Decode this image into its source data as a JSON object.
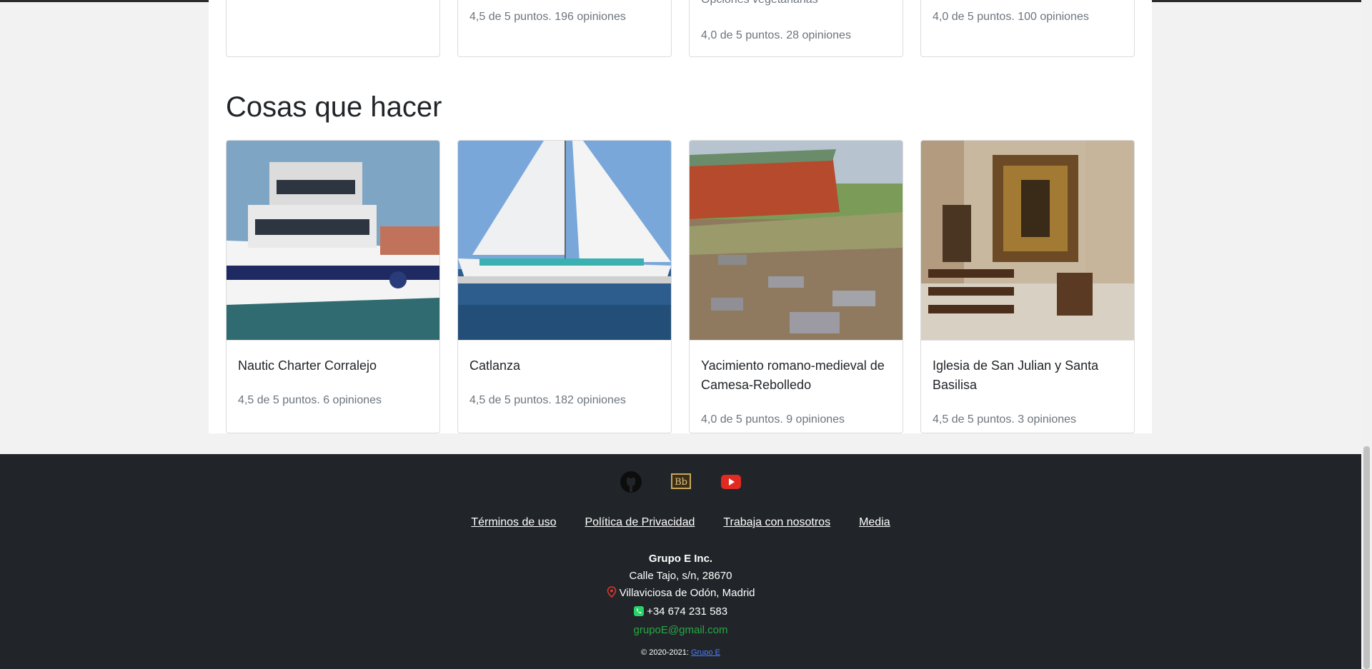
{
  "top_cards": [
    {
      "extra": "",
      "rating": ""
    },
    {
      "extra": "",
      "rating": "4,5 de 5 puntos. 196 opiniones"
    },
    {
      "extra": "Opciones vegetarianas",
      "rating": "4,0 de 5 puntos. 28 opiniones"
    },
    {
      "extra": "",
      "rating": "4,0 de 5 puntos. 100 opiniones"
    }
  ],
  "section": {
    "title": "Cosas que hacer"
  },
  "things": [
    {
      "title": "Nautic Charter Corralejo",
      "rating": "4,5 de 5 puntos. 6 opiniones",
      "image_icon": "yacht-photo"
    },
    {
      "title": "Catlanza",
      "rating": "4,5 de 5 puntos. 182 opiniones",
      "image_icon": "catamaran-photo"
    },
    {
      "title": "Yacimiento romano-medieval de Camesa-Rebolledo",
      "rating": "4,0 de 5 puntos. 9 opiniones",
      "image_icon": "ruins-photo"
    },
    {
      "title": "Iglesia de San Julian y Santa Basilisa",
      "rating": "4,5 de 5 puntos. 3 opiniones",
      "image_icon": "church-photo"
    }
  ],
  "footer": {
    "socials": [
      {
        "name": "github-icon"
      },
      {
        "name": "blackboard-icon",
        "text": "Bb"
      },
      {
        "name": "youtube-icon"
      }
    ],
    "links": [
      "Términos de uso",
      "Política de Privacidad",
      "Trabaja con nosotros",
      "Media"
    ],
    "company": "Grupo E Inc.",
    "street": "Calle Tajo, s/n, 28670",
    "city": "Villaviciosa de Odón, Madrid",
    "phone": "+34 674 231 583",
    "email": "grupoE@gmail.com",
    "copyright": "© 2020-2021:",
    "copyright_link": "Grupo E"
  },
  "colors": {
    "footer_bg": "#212529",
    "email_green": "#28a745",
    "muted": "#6c757d"
  }
}
